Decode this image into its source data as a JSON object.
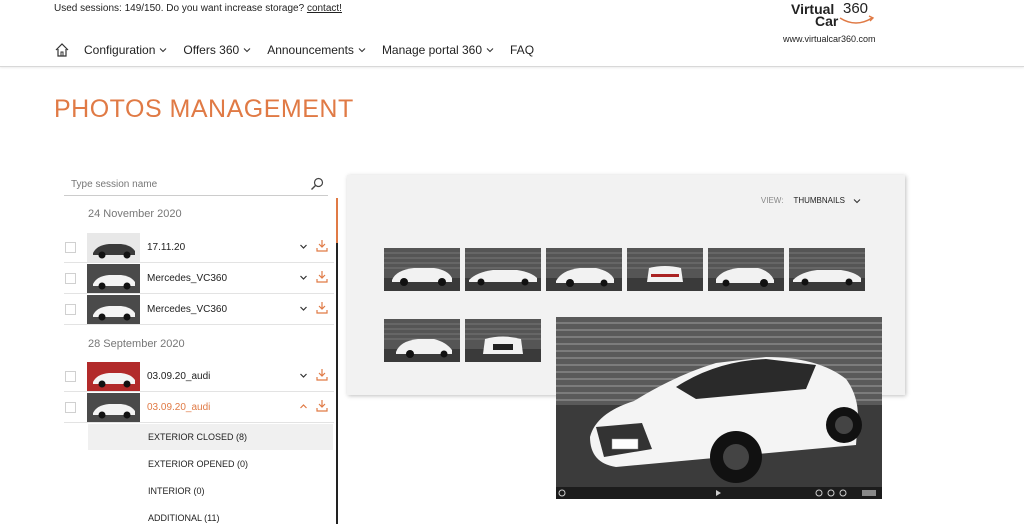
{
  "header": {
    "notice_text": "Used sessions: 149/150. Do you want increase storage?",
    "contact_label": "contact!",
    "nav": [
      {
        "label": "Configuration",
        "has_menu": true
      },
      {
        "label": "Offers 360",
        "has_menu": true
      },
      {
        "label": "Announcements",
        "has_menu": true
      },
      {
        "label": "Manage portal 360",
        "has_menu": true
      },
      {
        "label": "FAQ",
        "has_menu": false
      }
    ],
    "logo": {
      "line1": "Virtual",
      "line2": "Car",
      "num": "360",
      "url": "www.virtualcar360.com"
    }
  },
  "page": {
    "title": "PHOTOS MANAGEMENT"
  },
  "search": {
    "placeholder": "Type session name"
  },
  "sessions": {
    "groups": [
      {
        "date": "24 November 2020",
        "items": [
          {
            "name": "17.11.20",
            "expanded": false
          },
          {
            "name": "Mercedes_VC360",
            "expanded": false
          },
          {
            "name": "Mercedes_VC360",
            "expanded": false
          }
        ]
      },
      {
        "date": "28 September 2020",
        "items": [
          {
            "name": "03.09.20_audi",
            "expanded": false
          },
          {
            "name": "03.09.20_audi",
            "expanded": true
          }
        ]
      }
    ],
    "subfolders": [
      {
        "label": "EXTERIOR CLOSED (8)",
        "selected": true
      },
      {
        "label": "EXTERIOR OPENED (0)",
        "selected": false
      },
      {
        "label": "INTERIOR (0)",
        "selected": false
      },
      {
        "label": "ADDITIONAL (11)",
        "selected": false
      }
    ]
  },
  "gallery": {
    "view_label": "VIEW:",
    "view_value": "THUMBNAILS",
    "photo_count": 8
  },
  "colors": {
    "accent": "#e07a45",
    "panel_bg": "#f2f2f2"
  }
}
